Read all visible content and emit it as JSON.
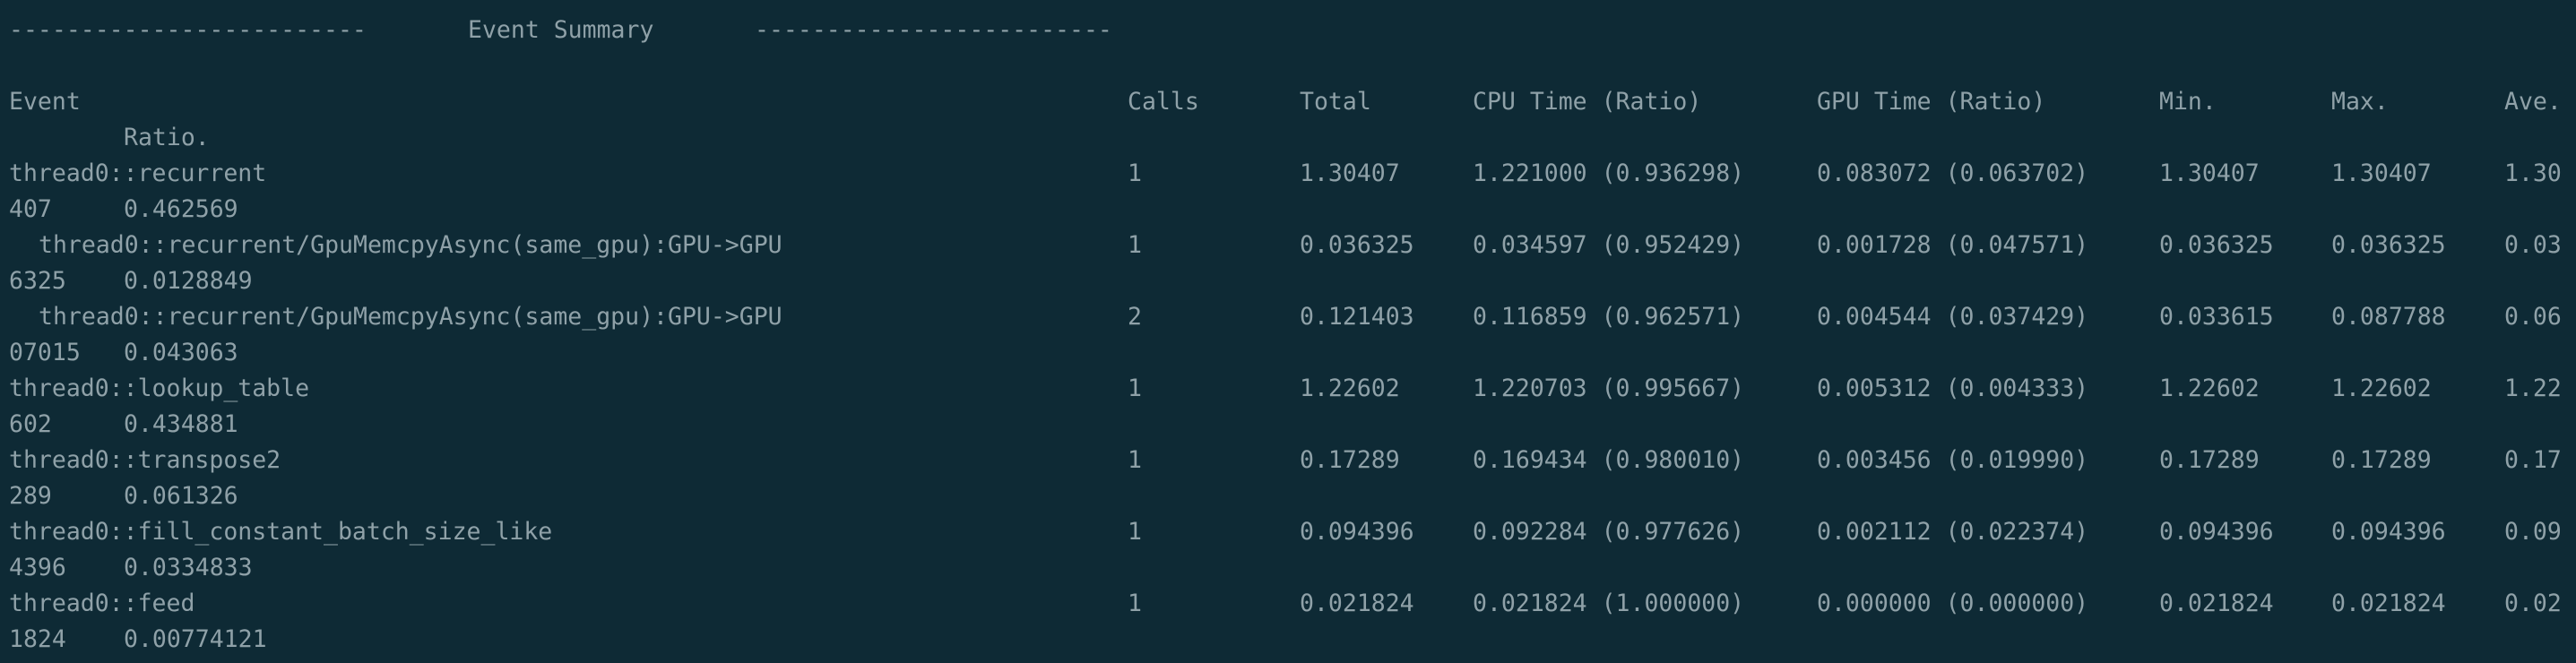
{
  "summary": {
    "dashes_left": "-------------------------",
    "title": "Event Summary",
    "dashes_right": "-------------------------"
  },
  "header": {
    "event": "Event",
    "calls": "Calls",
    "total": "Total",
    "cpu": "CPU Time (Ratio)",
    "gpu": "GPU Time (Ratio)",
    "min": "Min.",
    "max": "Max.",
    "ave": "Ave.",
    "ratio": "Ratio."
  },
  "rows": [
    {
      "event": "thread0::recurrent",
      "calls": "1",
      "total": "1.30407",
      "cpu": "1.221000 (0.936298)",
      "gpu": "0.083072 (0.063702)",
      "min": "1.30407",
      "max": "1.30407",
      "ave_start": "1.30",
      "ave_end": "407",
      "ratio": "0.462569"
    },
    {
      "event": "thread0::recurrent/GpuMemcpyAsync(same_gpu):GPU->GPU",
      "calls": "1",
      "total": "0.036325",
      "cpu": "0.034597 (0.952429)",
      "gpu": "0.001728 (0.047571)",
      "min": "0.036325",
      "max": "0.036325",
      "ave_start": "0.03",
      "ave_end": "6325",
      "ratio": "0.0128849"
    },
    {
      "event": "thread0::recurrent/GpuMemcpyAsync(same_gpu):GPU->GPU",
      "calls": "2",
      "total": "0.121403",
      "cpu": "0.116859 (0.962571)",
      "gpu": "0.004544 (0.037429)",
      "min": "0.033615",
      "max": "0.087788",
      "ave_start": "0.06",
      "ave_end": "07015",
      "ratio": "0.043063"
    },
    {
      "event": "thread0::lookup_table",
      "calls": "1",
      "total": "1.22602",
      "cpu": "1.220703 (0.995667)",
      "gpu": "0.005312 (0.004333)",
      "min": "1.22602",
      "max": "1.22602",
      "ave_start": "1.22",
      "ave_end": "602",
      "ratio": "0.434881"
    },
    {
      "event": "thread0::transpose2",
      "calls": "1",
      "total": "0.17289",
      "cpu": "0.169434 (0.980010)",
      "gpu": "0.003456 (0.019990)",
      "min": "0.17289",
      "max": "0.17289",
      "ave_start": "0.17",
      "ave_end": "289",
      "ratio": "0.061326"
    },
    {
      "event": "thread0::fill_constant_batch_size_like",
      "calls": "1",
      "total": "0.094396",
      "cpu": "0.092284 (0.977626)",
      "gpu": "0.002112 (0.022374)",
      "min": "0.094396",
      "max": "0.094396",
      "ave_start": "0.09",
      "ave_end": "4396",
      "ratio": "0.0334833"
    },
    {
      "event": "thread0::feed",
      "calls": "1",
      "total": "0.021824",
      "cpu": "0.021824 (1.000000)",
      "gpu": "0.000000 (0.000000)",
      "min": "0.021824",
      "max": "0.021824",
      "ave_start": "0.02",
      "ave_end": "1824",
      "ratio": "0.00774121"
    }
  ]
}
